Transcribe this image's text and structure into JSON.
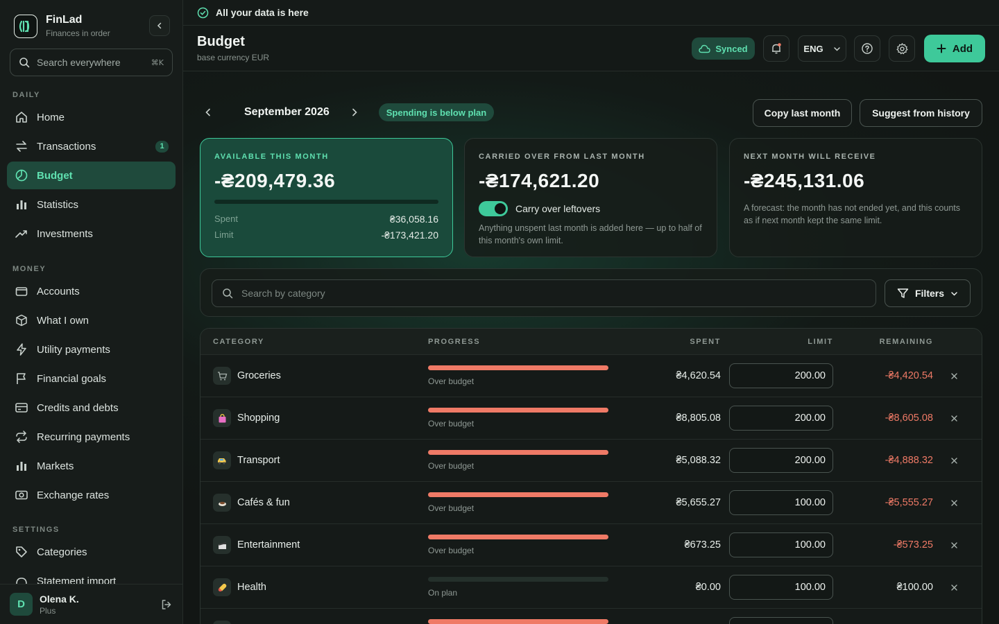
{
  "brand": {
    "name": "FinLad",
    "tagline": "Finances in order"
  },
  "sidebar": {
    "search_placeholder": "Search everywhere",
    "search_shortcut": "⌘K",
    "sections": [
      {
        "label": "DAILY",
        "items": [
          {
            "label": "Home",
            "icon": "home-icon"
          },
          {
            "label": "Transactions",
            "icon": "transfer-icon",
            "badge": "1"
          },
          {
            "label": "Budget",
            "icon": "budget-icon",
            "active": true
          },
          {
            "label": "Statistics",
            "icon": "bar-chart-icon"
          },
          {
            "label": "Investments",
            "icon": "trend-up-icon"
          }
        ]
      },
      {
        "label": "MONEY",
        "items": [
          {
            "label": "Accounts",
            "icon": "wallet-icon"
          },
          {
            "label": "What I own",
            "icon": "cube-icon"
          },
          {
            "label": "Utility payments",
            "icon": "bolt-icon"
          },
          {
            "label": "Financial goals",
            "icon": "flag-icon"
          },
          {
            "label": "Credits and debts",
            "icon": "card-icon"
          },
          {
            "label": "Recurring payments",
            "icon": "repeat-icon"
          },
          {
            "label": "Markets",
            "icon": "bar-chart-icon"
          },
          {
            "label": "Exchange rates",
            "icon": "banknote-icon"
          }
        ]
      },
      {
        "label": "SETTINGS",
        "items": [
          {
            "label": "Categories",
            "icon": "tag-icon"
          },
          {
            "label": "Statement import",
            "icon": "import-icon"
          }
        ]
      }
    ]
  },
  "user": {
    "initial": "D",
    "name": "Olena K.",
    "plan": "Plus"
  },
  "topbar": {
    "message": "All your data is here"
  },
  "header": {
    "title": "Budget",
    "subtitle": "base currency EUR",
    "synced_label": "Synced",
    "language": "ENG",
    "add_label": "Add"
  },
  "month": {
    "label": "September 2026",
    "status": "Spending is below plan",
    "copy_label": "Copy last month",
    "suggest_label": "Suggest from history"
  },
  "cards": {
    "available": {
      "title": "AVAILABLE THIS MONTH",
      "amount": "-₴209,479.36",
      "spent_label": "Spent",
      "spent_value": "₴36,058.16",
      "limit_label": "Limit",
      "limit_value": "-₴173,421.20",
      "progress": 0
    },
    "carried": {
      "title": "CARRIED OVER FROM LAST MONTH",
      "amount": "-₴174,621.20",
      "toggle_label": "Carry over leftovers",
      "toggle_on": true,
      "note": "Anything unspent last month is added here — up to half of this month's own limit."
    },
    "next": {
      "title": "NEXT MONTH WILL RECEIVE",
      "amount": "-₴245,131.06",
      "note": "A forecast: the month has not ended yet, and this counts as if next month kept the same limit."
    }
  },
  "filter": {
    "search_placeholder": "Search by category",
    "filters_label": "Filters"
  },
  "table": {
    "headers": {
      "category": "CATEGORY",
      "progress": "PROGRESS",
      "spent": "SPENT",
      "limit": "LIMIT",
      "remaining": "REMAINING"
    },
    "rows": [
      {
        "name": "Groceries",
        "icon": "cart-icon",
        "progress": 1,
        "status": "Over budget",
        "spent": "₴4,620.54",
        "limit": "200.00",
        "remaining": "-₴4,420.54",
        "negative": true
      },
      {
        "name": "Shopping",
        "icon": "shopping-bag-icon",
        "progress": 1,
        "status": "Over budget",
        "spent": "₴8,805.08",
        "limit": "200.00",
        "remaining": "-₴8,605.08",
        "negative": true
      },
      {
        "name": "Transport",
        "icon": "car-icon",
        "progress": 1,
        "status": "Over budget",
        "spent": "₴5,088.32",
        "limit": "200.00",
        "remaining": "-₴4,888.32",
        "negative": true
      },
      {
        "name": "Cafés & fun",
        "icon": "coffee-icon",
        "progress": 1,
        "status": "Over budget",
        "spent": "₴5,655.27",
        "limit": "100.00",
        "remaining": "-₴5,555.27",
        "negative": true
      },
      {
        "name": "Entertainment",
        "icon": "clapper-icon",
        "progress": 1,
        "status": "Over budget",
        "spent": "₴673.25",
        "limit": "100.00",
        "remaining": "-₴573.25",
        "negative": true
      },
      {
        "name": "Health",
        "icon": "pill-icon",
        "progress": 0,
        "status": "On plan",
        "spent": "₴0.00",
        "limit": "100.00",
        "remaining": "₴100.00",
        "negative": false
      },
      {
        "name": "",
        "icon": "category-icon",
        "progress": 1,
        "status": "",
        "spent": "",
        "limit": "",
        "remaining": "",
        "negative": true
      }
    ]
  },
  "colors": {
    "accent": "#3ec99a",
    "accent_bg": "#1f4a3c",
    "danger": "#ef7a66"
  }
}
